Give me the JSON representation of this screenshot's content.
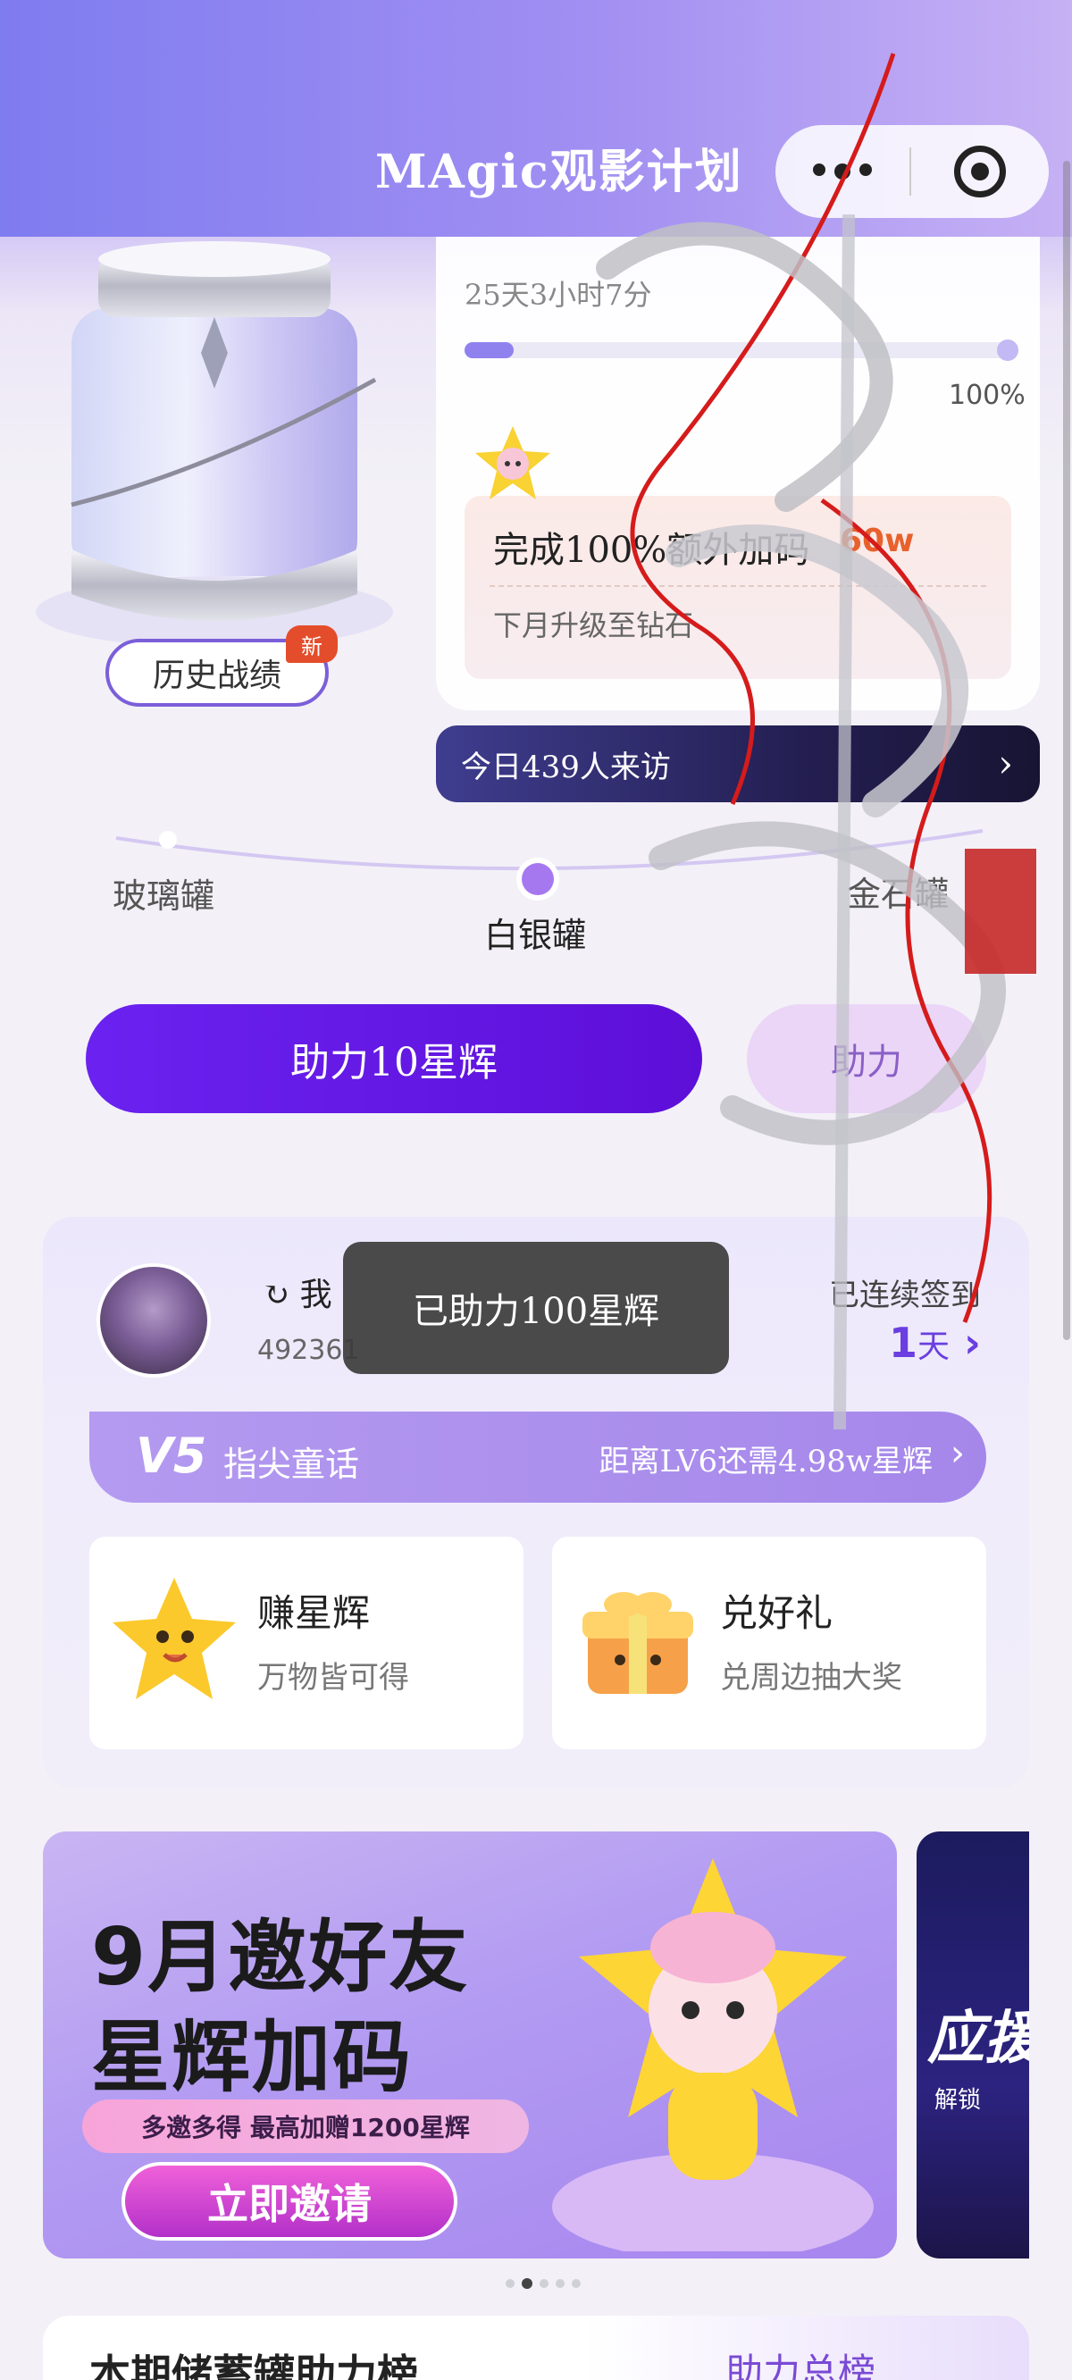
{
  "header": {
    "title": "MAgic观影计划",
    "more_icon": "more-dots-icon",
    "target_icon": "target-icon"
  },
  "jar": {
    "history_label": "历史战绩",
    "new_badge": "新"
  },
  "goal": {
    "countdown": "25天3小时7分",
    "progress_percent": 100,
    "progress_label": "100%",
    "bonus_title": "完成100%额外加码",
    "bonus_value": "60w",
    "bonus_sub": "下月升级至钻石"
  },
  "visitors": {
    "text": "今日439人来访"
  },
  "levels": {
    "items": [
      "玻璃罐",
      "白银罐",
      "金石罐"
    ],
    "active_index": 1
  },
  "actions": {
    "boost_label": "助力10星辉",
    "boost2_label": "助力"
  },
  "toast": {
    "text": "已助力100星辉"
  },
  "user": {
    "name": "我",
    "id": "492361",
    "signin_label": "已连续签到",
    "signin_days": "1",
    "signin_unit": "天",
    "level_tag": "V5",
    "level_name": "指尖童话",
    "level_next": "距离LV6还需4.98w星辉"
  },
  "tiles": [
    {
      "title": "赚星辉",
      "sub": "万物皆可得",
      "icon": "star-mascot-icon"
    },
    {
      "title": "兑好礼",
      "sub": "兑周边抽大奖",
      "icon": "gift-box-icon"
    }
  ],
  "banner": {
    "title_line1": "9月邀好友",
    "title_line2": "星辉加码",
    "sub": "多邀多得 最高加赠1200星辉",
    "cta": "立即邀请",
    "next_title": "应援",
    "next_sub": "解锁"
  },
  "carousel": {
    "count": 5,
    "active_index": 1
  },
  "bottom": {
    "title": "本期储蓄罐助力榜",
    "right": "助力总榜"
  },
  "colors": {
    "accent": "#6b22f0",
    "header": "#8a86f2",
    "bonus": "#e8612d"
  }
}
